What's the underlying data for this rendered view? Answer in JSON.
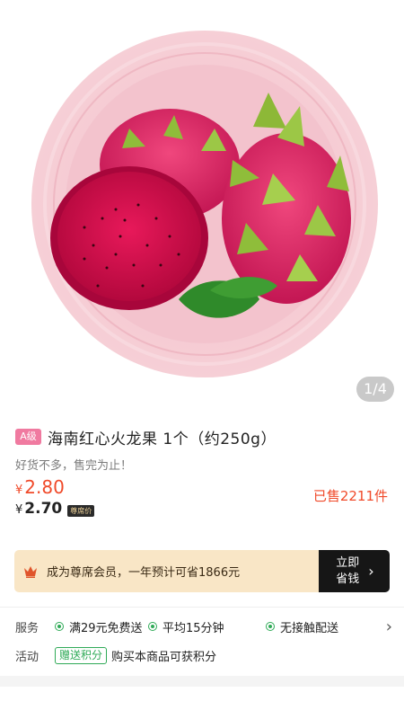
{
  "gallery": {
    "counter": "1/4",
    "image_alt": "海南红心火龙果"
  },
  "product": {
    "grade_badge": "A级",
    "title": "海南红心火龙果  1个（约250g）",
    "slogan": "好货不多，售完为止！"
  },
  "price": {
    "currency_symbol": "¥",
    "current": "2.80",
    "member_price": "2.70",
    "member_tag": "尊席价",
    "sold": "已售2211件"
  },
  "membership": {
    "promo_text": "成为尊席会员，一年预计可省1866元",
    "button_label": "立即省钱",
    "arrow": "›"
  },
  "service": {
    "label": "服务",
    "items": [
      "满29元免费送",
      "平均15分钟",
      "无接触配送"
    ],
    "chevron": "›"
  },
  "activity": {
    "label": "活动",
    "tag": "赠送积分",
    "text": "购买本商品可获积分"
  },
  "colors": {
    "price_red": "#f04a2a",
    "badge_pink": "#f07aa0",
    "member_bar_bg": "#f9e6c6",
    "member_btn_bg": "#161616",
    "service_green": "#2faa57",
    "plate_pink": "#f5c7d0"
  }
}
